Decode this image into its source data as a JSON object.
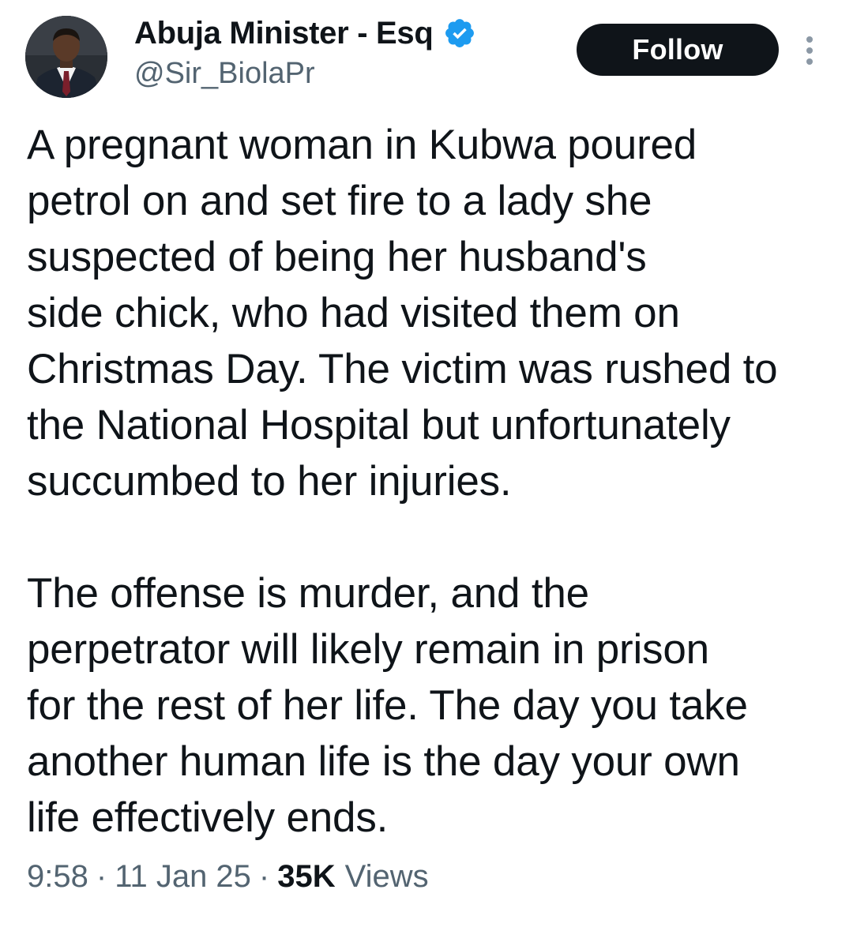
{
  "author": {
    "display_name": "Abuja Minister - Esq",
    "handle": "@Sir_BiolaPr",
    "verified": true,
    "verified_color": "#1d9bf0"
  },
  "actions": {
    "follow_label": "Follow",
    "more_icon": "more-vertical-icon"
  },
  "tweet": {
    "paragraphs": [
      "A pregnant woman in Kubwa poured\npetrol on and set fire to a lady she\nsuspected of being her husband's\nside chick, who had visited them on\nChristmas Day. The victim was rushed to\nthe National Hospital but unfortunately\nsuccumbed to her injuries.",
      "The offense is murder, and the\nperpetrator will likely remain in prison\nfor the rest of her life. The day you take\nanother human life is the day your own\nlife effectively ends."
    ]
  },
  "meta": {
    "time": "9:58",
    "separator": "·",
    "date": "11 Jan 25",
    "views_count": "35K",
    "views_label": "Views"
  },
  "colors": {
    "text_primary": "#0f1419",
    "text_secondary": "#536471",
    "button_bg": "#0f1419",
    "button_text": "#ffffff"
  }
}
